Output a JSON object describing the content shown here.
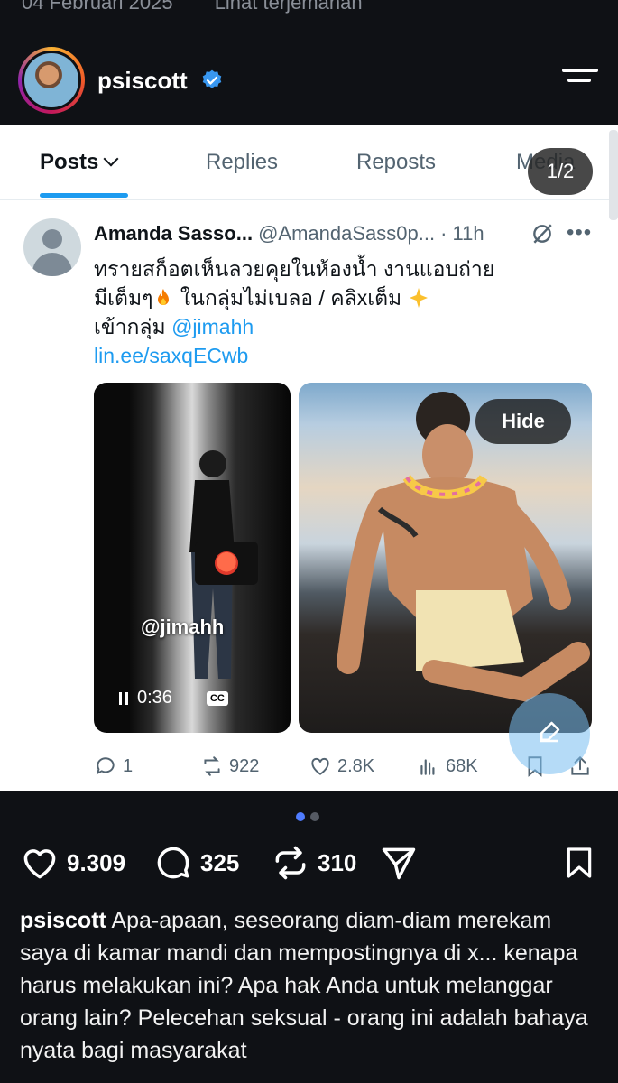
{
  "top_cut": {
    "date": "04 Februari 2025",
    "translation": "Lihat terjemahan"
  },
  "header": {
    "username": "psiscott"
  },
  "embedded": {
    "tabs": [
      "Posts",
      "Replies",
      "Reposts",
      "Media"
    ],
    "page_counter": "1/2",
    "tweet": {
      "name": "Amanda Sasso...",
      "handle": "@AmandaSass0p...",
      "time": "· 11h",
      "line1": "ทรายสก็อตเห็นลวยคุยในห้องน้ำ งานแอบถ่าย",
      "line2a": "มีเต็มๆ",
      "line2b": " ในกลุ่มไม่เบลอ / คลิxเต็ม ",
      "line3a": "เข้ากลุ่ม ",
      "mention": "@jimahh",
      "link": "lin.ee/saxqECwb"
    },
    "video": {
      "watermark": "@jimahh",
      "time": "0:36",
      "cc": "CC"
    },
    "hide_label": "Hide",
    "stats": {
      "replies": "1",
      "reposts": "922",
      "likes": "2.8K",
      "views": "68K"
    }
  },
  "post_actions": {
    "likes": "9.309",
    "comments": "325",
    "shares": "310"
  },
  "caption": {
    "username": "psiscott",
    "text": "Apa-apaan, seseorang diam-diam merekam saya di kamar mandi dan mempostingnya di x... kenapa harus melakukan ini? Apa hak Anda untuk melanggar orang lain? Pelecehan seksual - orang ini adalah bahaya nyata bagi masyarakat"
  },
  "colors": {
    "twitter_blue": "#1d9bf0",
    "background": "#0f1115",
    "dot_active": "#4f7cff"
  }
}
